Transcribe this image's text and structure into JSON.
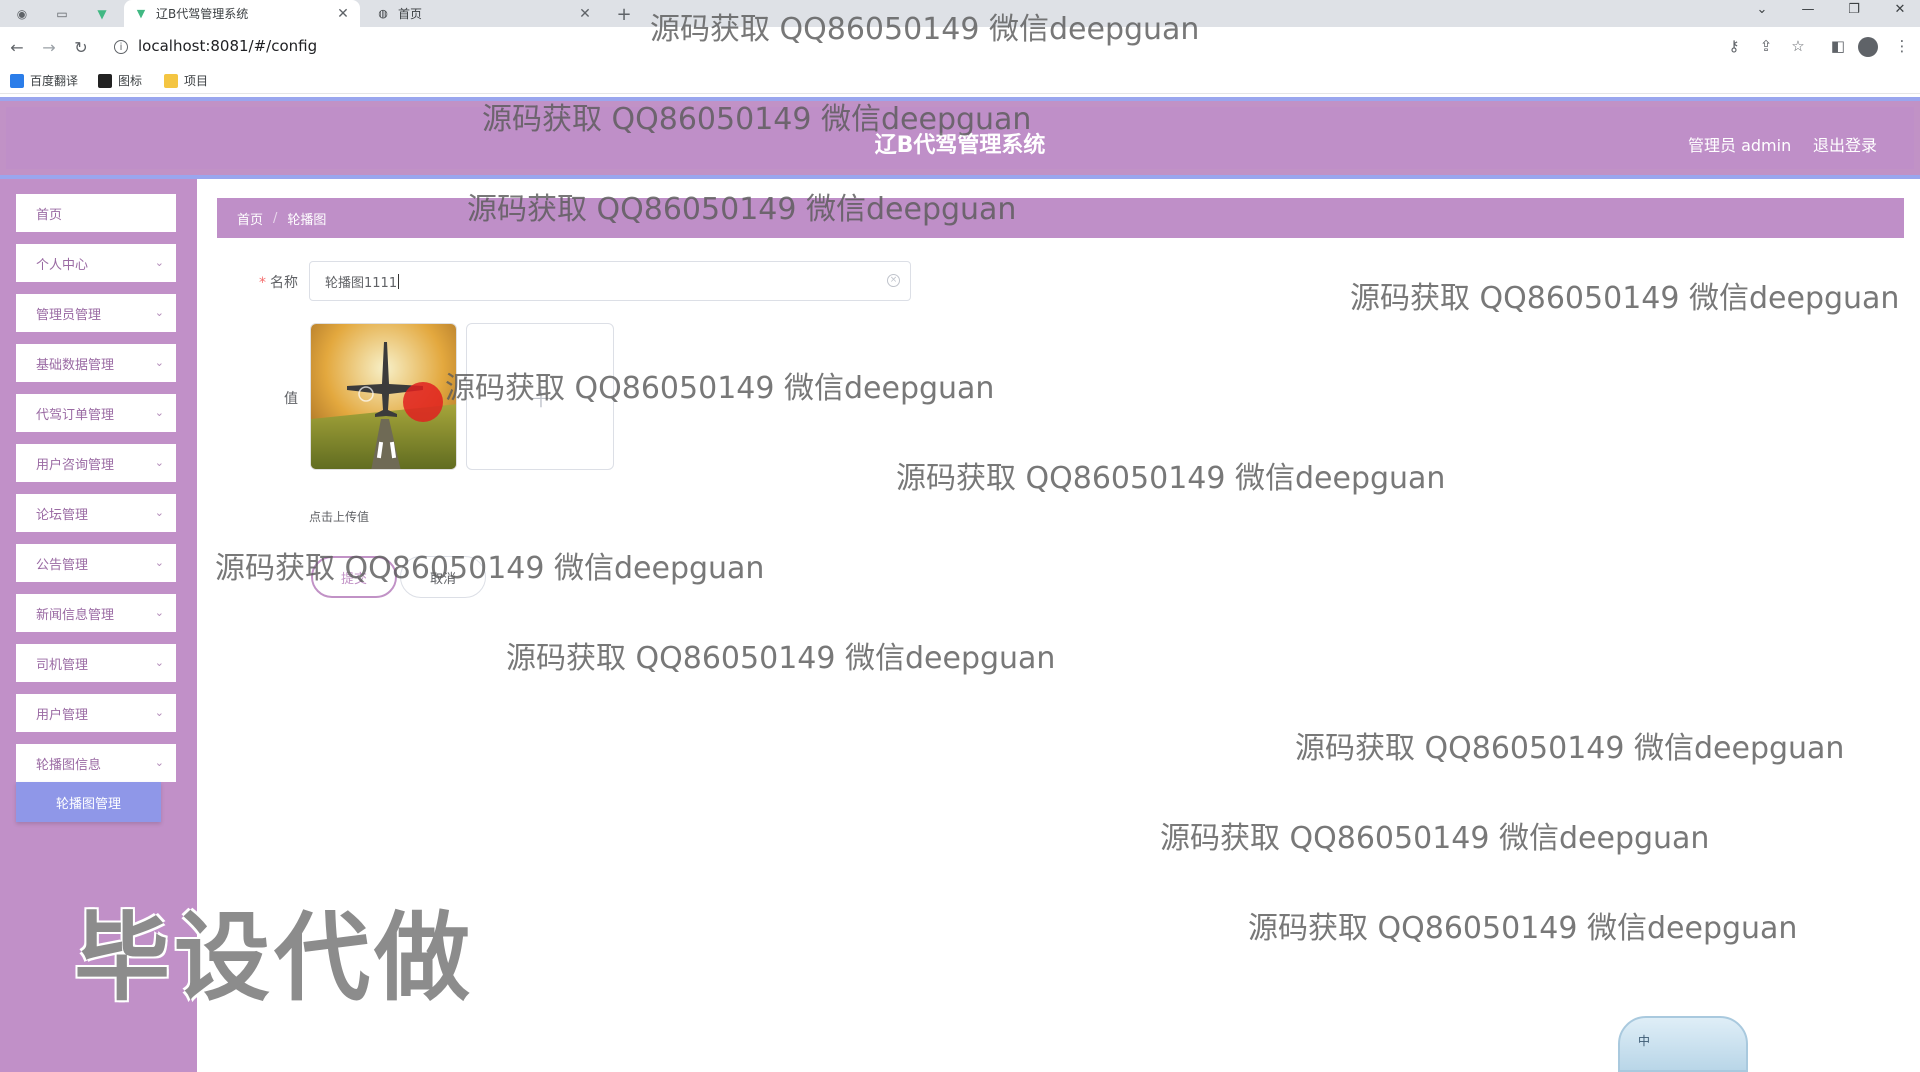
{
  "browser": {
    "tabs": [
      {
        "title": "辽B代驾管理系统",
        "active": true
      },
      {
        "title": "首页",
        "active": false
      }
    ],
    "new_tab": "+",
    "url": "localhost:8081/#/config",
    "bookmarks": [
      {
        "label": "百度翻译",
        "color": "#2b7de9"
      },
      {
        "label": "图标",
        "color": "#222222"
      },
      {
        "label": "项目",
        "color": "#f4c542"
      }
    ]
  },
  "header": {
    "title": "辽B代驾管理系统",
    "user_label": "管理员 admin",
    "logout_label": "退出登录"
  },
  "sidebar": {
    "items": [
      {
        "label": "首页",
        "has_children": false
      },
      {
        "label": "个人中心",
        "has_children": true
      },
      {
        "label": "管理员管理",
        "has_children": true
      },
      {
        "label": "基础数据管理",
        "has_children": true
      },
      {
        "label": "代驾订单管理",
        "has_children": true
      },
      {
        "label": "用户咨询管理",
        "has_children": true
      },
      {
        "label": "论坛管理",
        "has_children": true
      },
      {
        "label": "公告管理",
        "has_children": true
      },
      {
        "label": "新闻信息管理",
        "has_children": true
      },
      {
        "label": "司机管理",
        "has_children": true
      },
      {
        "label": "用户管理",
        "has_children": true
      },
      {
        "label": "轮播图信息",
        "has_children": true
      }
    ],
    "active_sub": "轮播图管理"
  },
  "breadcrumb": [
    "首页",
    "轮播图"
  ],
  "form": {
    "name_label": "名称",
    "name_value": "轮播图1111",
    "value_label": "值",
    "upload_tip": "点击上传值",
    "submit_label": "提交",
    "cancel_label": "取消"
  },
  "watermark_text": "源码获取 QQ86050149 微信deepguan",
  "watermark_big": "毕设代做",
  "ime_label": "中",
  "colors": {
    "primary": "#c192c6",
    "header_border": "#9aa6ee",
    "submenu_active": "#8f97e8"
  }
}
